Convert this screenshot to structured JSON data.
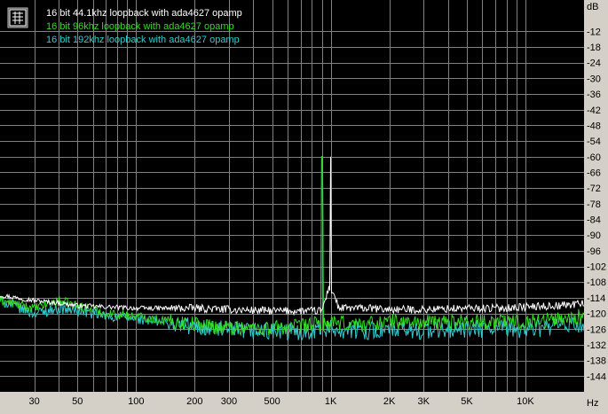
{
  "colors": {
    "background": "#000000",
    "frame": "#d4d0c8",
    "grid": "#808080",
    "series_white": "#ffffff",
    "series_green": "#33dd22",
    "series_cyan": "#33cccc"
  },
  "legend_icon": "chart-legend-icon",
  "chart_data": {
    "type": "line",
    "title": "",
    "xlabel": "Hz",
    "ylabel": "dB",
    "x_scale": "log",
    "xlim": [
      20,
      20000
    ],
    "ylim": [
      -150,
      0
    ],
    "grid": true,
    "legend_position": "top-left",
    "x_ticks": [
      {
        "value": 30,
        "label": "30"
      },
      {
        "value": 50,
        "label": "50"
      },
      {
        "value": 100,
        "label": "100"
      },
      {
        "value": 200,
        "label": "200"
      },
      {
        "value": 300,
        "label": "300"
      },
      {
        "value": 500,
        "label": "500"
      },
      {
        "value": 1000,
        "label": "1K"
      },
      {
        "value": 2000,
        "label": "2K"
      },
      {
        "value": 3000,
        "label": "3K"
      },
      {
        "value": 5000,
        "label": "5K"
      },
      {
        "value": 10000,
        "label": "10K"
      }
    ],
    "y_ticks": [
      {
        "value": -12,
        "label": "-12"
      },
      {
        "value": -18,
        "label": "-18"
      },
      {
        "value": -24,
        "label": "-24"
      },
      {
        "value": -30,
        "label": "-30"
      },
      {
        "value": -36,
        "label": "-36"
      },
      {
        "value": -42,
        "label": "-42"
      },
      {
        "value": -48,
        "label": "-48"
      },
      {
        "value": -54,
        "label": "-54"
      },
      {
        "value": -60,
        "label": "-60"
      },
      {
        "value": -66,
        "label": "-66"
      },
      {
        "value": -72,
        "label": "-72"
      },
      {
        "value": -78,
        "label": "-78"
      },
      {
        "value": -84,
        "label": "-84"
      },
      {
        "value": -90,
        "label": "-90"
      },
      {
        "value": -96,
        "label": "-96"
      },
      {
        "value": -102,
        "label": "-102"
      },
      {
        "value": -108,
        "label": "-108"
      },
      {
        "value": -114,
        "label": "-114"
      },
      {
        "value": -120,
        "label": "-120"
      },
      {
        "value": -126,
        "label": "-126"
      },
      {
        "value": -132,
        "label": "-132"
      },
      {
        "value": -138,
        "label": "-138"
      },
      {
        "value": -144,
        "label": "-144"
      }
    ],
    "series": [
      {
        "name": "16 bit 44.1khz loopback with ada4627 opamp",
        "color": "#ffffff",
        "x": [
          20,
          30,
          40,
          50,
          70,
          100,
          150,
          200,
          300,
          500,
          700,
          900,
          980,
          1000,
          1030,
          1100,
          1500,
          2000,
          3000,
          5000,
          7000,
          10000,
          15000,
          20000
        ],
        "y": [
          -113,
          -115,
          -116,
          -117,
          -117.5,
          -118,
          -118,
          -118,
          -118.5,
          -119,
          -119,
          -119,
          -110,
          -60,
          -112,
          -118,
          -118,
          -118.5,
          -118.5,
          -118,
          -118,
          -117.5,
          -117,
          -116
        ]
      },
      {
        "name": "16 bit 96khz loopback with ada4627 opamp",
        "color": "#33dd22",
        "x": [
          20,
          30,
          40,
          50,
          70,
          100,
          150,
          200,
          300,
          500,
          700,
          850,
          900,
          950,
          1000,
          1500,
          2000,
          3000,
          5000,
          7000,
          10000,
          15000,
          20000
        ],
        "y": [
          -115,
          -118,
          -115,
          -117,
          -120,
          -121,
          -123,
          -124,
          -125.5,
          -125.5,
          -125,
          -124,
          -60,
          -124,
          -124,
          -124,
          -123,
          -123.5,
          -123,
          -123,
          -123,
          -122,
          -121
        ]
      },
      {
        "name": "16 bit 192khz loopback with ada4627 opamp",
        "color": "#33cccc",
        "x": [
          20,
          30,
          40,
          50,
          70,
          100,
          150,
          200,
          300,
          500,
          700,
          850,
          900,
          950,
          1000,
          1500,
          2000,
          3000,
          5000,
          7000,
          10000,
          15000,
          20000
        ],
        "y": [
          -115,
          -120,
          -118,
          -119,
          -121,
          -122,
          -124,
          -125,
          -126.5,
          -127,
          -127,
          -126,
          -60,
          -126,
          -126,
          -126.5,
          -126.5,
          -126.5,
          -126,
          -126,
          -126,
          -125,
          -124
        ]
      }
    ]
  }
}
